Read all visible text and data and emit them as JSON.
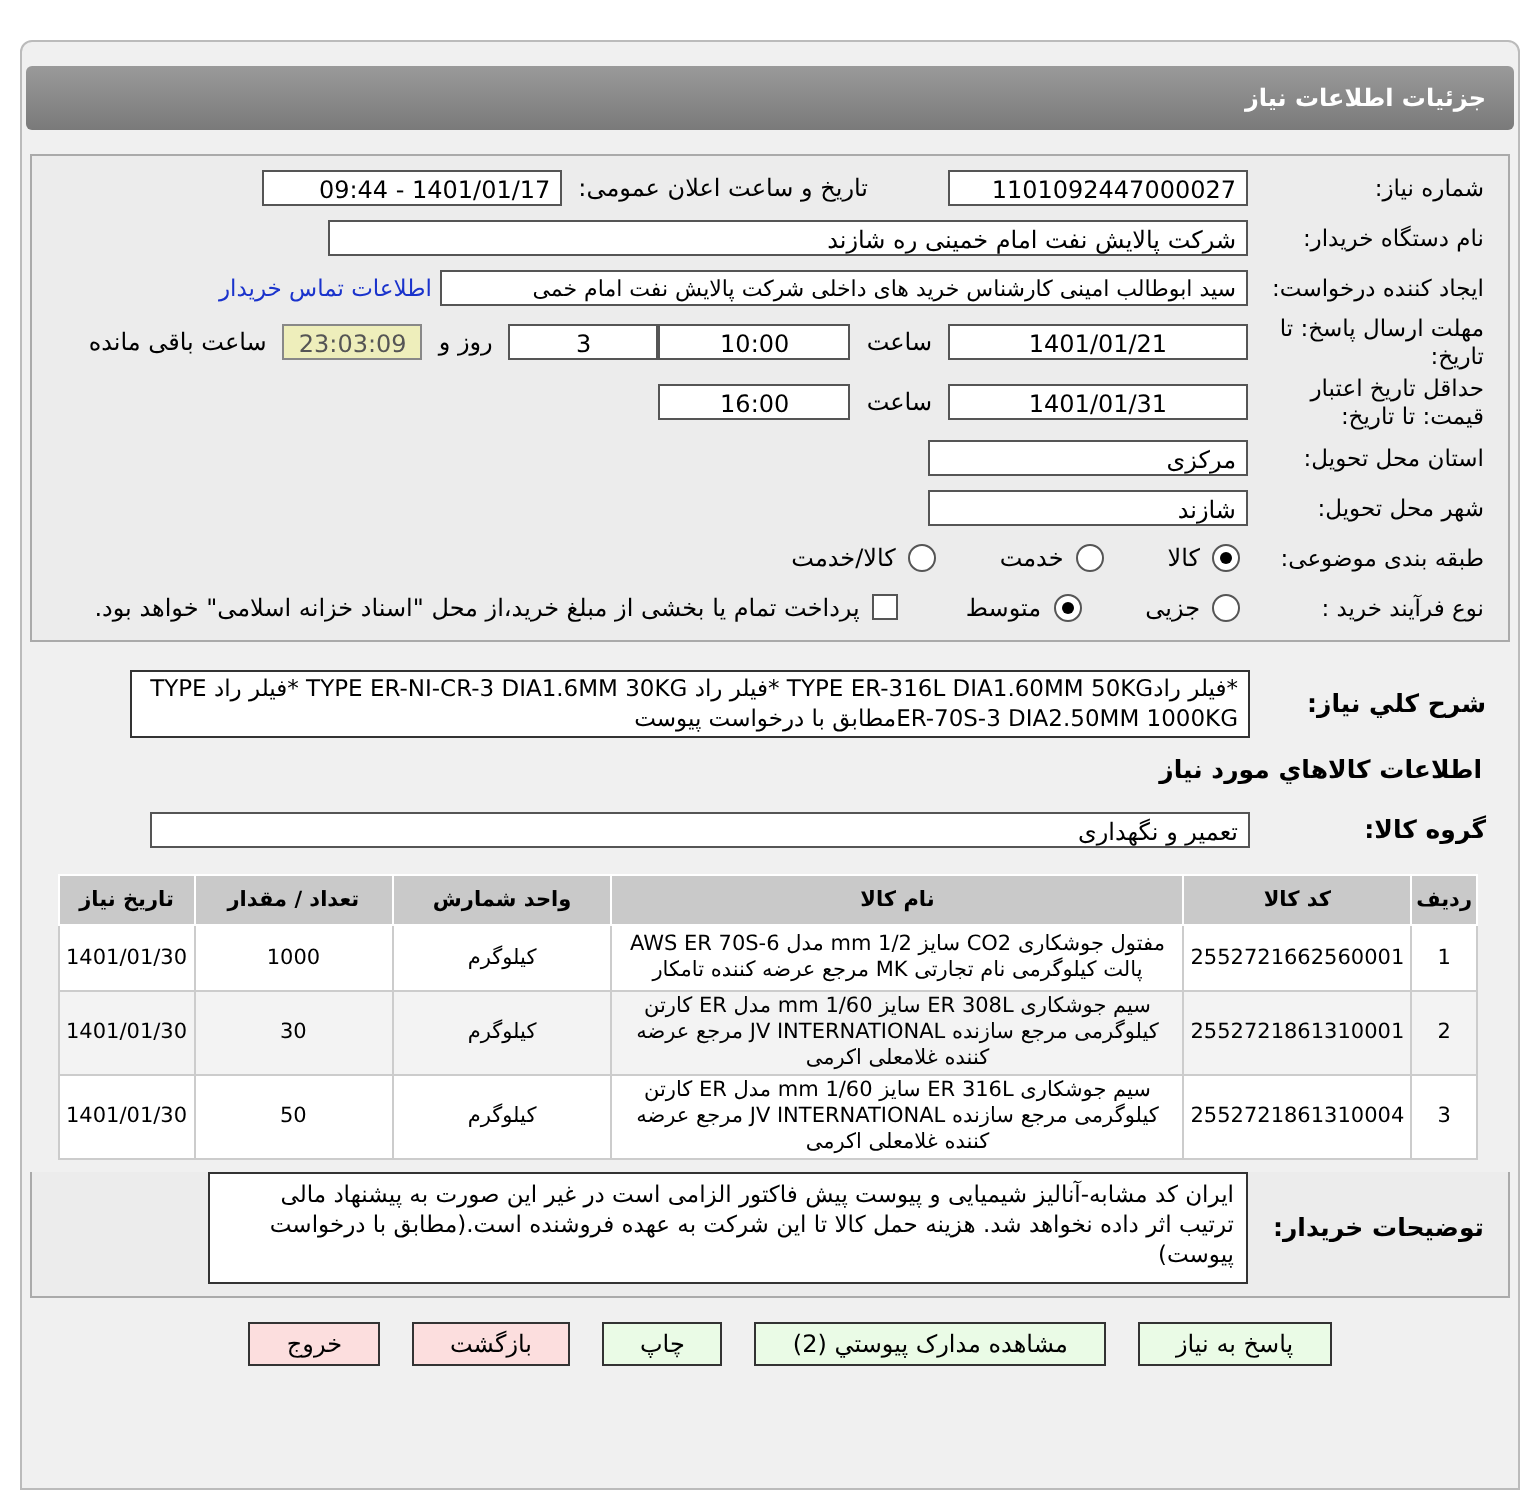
{
  "header": {
    "title": "جزئیات اطلاعات نیاز"
  },
  "need_number": {
    "label": "شماره نیاز:",
    "value": "1101092447000027"
  },
  "announce": {
    "label": "تاریخ و ساعت اعلان عمومی:",
    "value": "1401/01/17 - 09:44"
  },
  "buyer_org": {
    "label": "نام دستگاه خریدار:",
    "value": "شرکت پالایش نفت امام خمینی  ره  شازند"
  },
  "requester": {
    "label": "ایجاد کننده درخواست:",
    "value": "سید ابوطالب  امینی کارشناس خرید های داخلی  شرکت پالایش نفت امام خمی",
    "link": "اطلاعات تماس خریدار"
  },
  "deadline": {
    "label": "مهلت ارسال پاسخ: تا تاریخ:",
    "date": "1401/01/21",
    "time_label": "ساعت",
    "time": "10:00",
    "days": "3",
    "days_label": "روز و",
    "remaining": "23:03:09",
    "remaining_label": "ساعت باقی مانده"
  },
  "validity": {
    "label": "حداقل تاریخ اعتبار قیمت: تا تاریخ:",
    "date": "1401/01/31",
    "time_label": "ساعت",
    "time": "16:00"
  },
  "province": {
    "label": "استان محل تحویل:",
    "value": "مرکزی"
  },
  "city": {
    "label": "شهر محل تحویل:",
    "value": "شازند"
  },
  "category": {
    "label": "طبقه بندی موضوعی:",
    "options": [
      {
        "label": "کالا",
        "selected": true
      },
      {
        "label": "خدمت",
        "selected": false
      },
      {
        "label": "کالا/خدمت",
        "selected": false
      }
    ]
  },
  "process": {
    "label": "نوع فرآیند خرید :",
    "options": [
      {
        "label": "جزیی",
        "selected": false
      },
      {
        "label": "متوسط",
        "selected": true
      }
    ],
    "payment": {
      "checked": false,
      "text": "پرداخت تمام یا بخشی از مبلغ خرید،از محل \"اسناد خزانه اسلامی\" خواهد بود."
    }
  },
  "description": {
    "label": "شرح کلي نياز:",
    "text": "*فیلر رادTYPE ER-316L DIA1.60MM 50KG *فیلر راد TYPE ER-NI-CR-3 DIA1.6MM 30KG   *فیلر راد TYPE ER-70S-3 DIA2.50MM  1000KGمطابق با درخواست پیوست"
  },
  "goods_title": "اطلاعات كالاهاي مورد نياز",
  "group": {
    "label": "گروه کالا:",
    "value": "تعمیر و نگهداری"
  },
  "table": {
    "columns": [
      "ردیف",
      "کد کالا",
      "نام کالا",
      "واحد شمارش",
      "تعداد / مقدار",
      "تاریخ نیاز"
    ],
    "rows": [
      [
        "1",
        "2552721662560001",
        "مفتول جوشکاری CO2 سایز 1/2 mm مدل AWS ER 70S-6 پالت کیلوگرمی نام تجارتی MK مرجع عرضه کننده تامکار",
        "کیلوگرم",
        "1000",
        "1401/01/30"
      ],
      [
        "2",
        "2552721861310001",
        "سیم جوشکاری ER 308L سایز 1/60 mm مدل ER کارتن کیلوگرمی مرجع سازنده JV INTERNATIONAL مرجع عرضه کننده غلامعلی اکرمی",
        "کیلوگرم",
        "30",
        "1401/01/30"
      ],
      [
        "3",
        "2552721861310004",
        "سیم جوشکاری ER 316L سایز 1/60 mm مدل ER کارتن کیلوگرمی مرجع سازنده JV INTERNATIONAL مرجع عرضه کننده غلامعلی اکرمی",
        "کیلوگرم",
        "50",
        "1401/01/30"
      ]
    ]
  },
  "buyer_notes": {
    "label": "توضیحات خریدار:",
    "text": "ایران کد مشابه-آنالیز شیمیایی و پیوست پیش فاکتور الزامی است در غیر این صورت به پیشنهاد مالی ترتیب اثر داده نخواهد شد. هزینه حمل کالا تا این شرکت به عهده فروشنده است.(مطابق با درخواست پیوست)"
  },
  "buttons": [
    {
      "label": "پاسخ به نیاز",
      "kind": "green"
    },
    {
      "label": "مشاهده مدارک پیوستي (2)",
      "kind": "green"
    },
    {
      "label": "چاپ",
      "kind": "green"
    },
    {
      "label": "بازگشت",
      "kind": "red"
    },
    {
      "label": "خروج",
      "kind": "red"
    }
  ]
}
